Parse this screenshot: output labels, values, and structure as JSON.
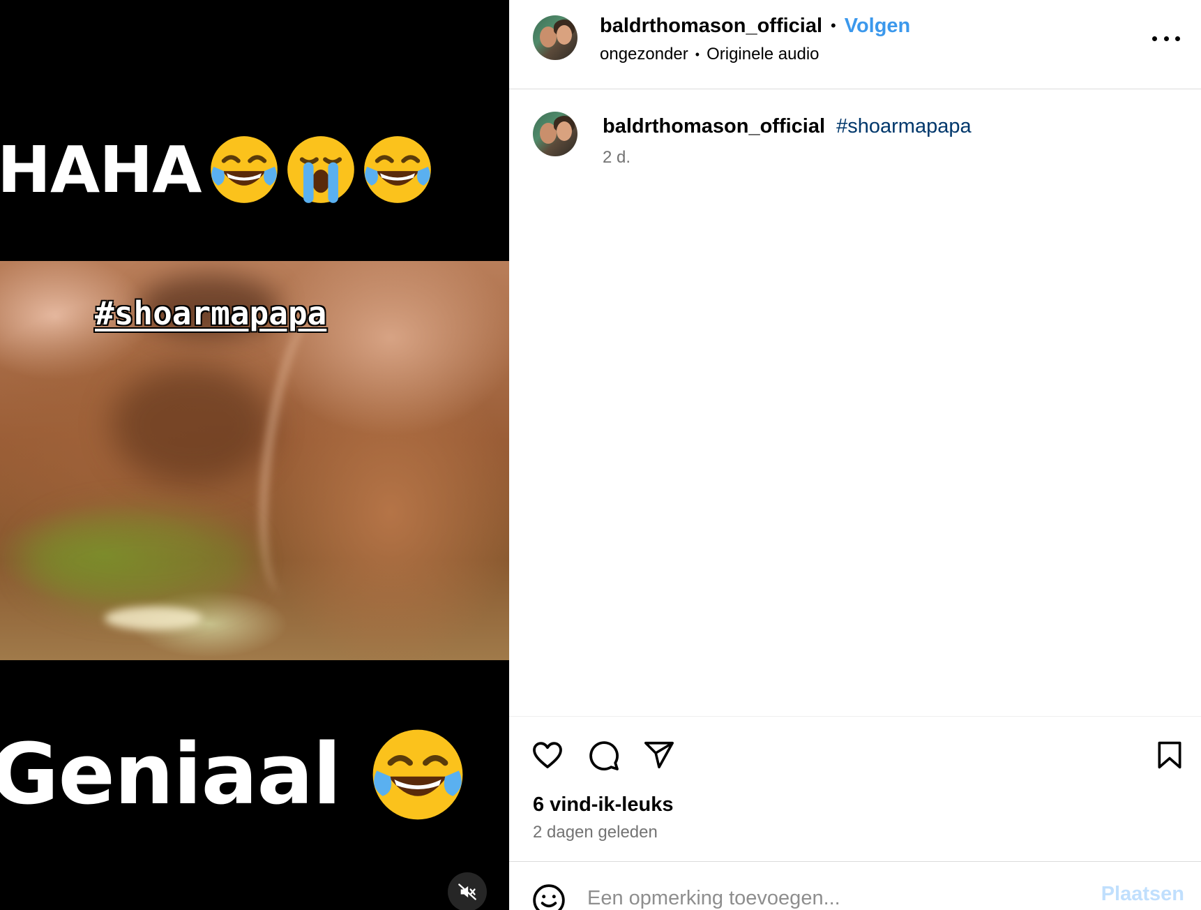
{
  "media": {
    "caption_top": "HAHA",
    "caption_top_emojis": [
      "face-with-tears-of-joy",
      "loudly-crying-face",
      "face-with-tears-of-joy"
    ],
    "hashtag_overlay": "#shoarmapapa",
    "caption_bottom": "Geniaal",
    "caption_bottom_emojis": [
      "face-with-tears-of-joy"
    ],
    "mute_icon": "speaker-muted-icon"
  },
  "header": {
    "username": "baldrthomason_official",
    "separator": "•",
    "follow_label": "Volgen",
    "subtitle_left": "ongezonder",
    "subtitle_right": "Originele audio",
    "more_icon": "more-horizontal-icon"
  },
  "comment": {
    "username": "baldrthomason_official",
    "hashtag": "#shoarmapapa",
    "time": "2 d."
  },
  "actions": {
    "icons": [
      "heart-icon",
      "comment-bubble-icon",
      "paper-plane-icon",
      "bookmark-icon"
    ],
    "likes": "6 vind-ik-leuks",
    "date": "2 dagen geleden"
  },
  "add_comment": {
    "placeholder": "Een opmerking toevoegen...",
    "post_label": "Plaatsen",
    "emoji_icon": "smiley-icon"
  },
  "colors": {
    "follow": "#3b98ec",
    "hashtag_link": "#00376b",
    "muted_text": "#737373",
    "post_button_disabled": "#c0dffd"
  }
}
